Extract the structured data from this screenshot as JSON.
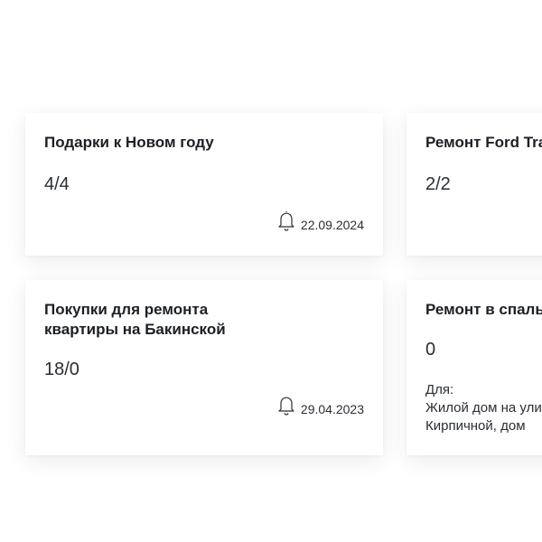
{
  "cards": [
    {
      "title": "Подарки к Новом году",
      "count": "4/4",
      "date": "22.09.2024",
      "icon": "bell-icon"
    },
    {
      "title": "Ремонт Ford Transit",
      "count": "2/2"
    },
    {
      "title": "Покупки для ремонта\nквартиры на Бакинской",
      "count": "18/0",
      "date": "29.04.2023",
      "icon": "bell-icon"
    },
    {
      "title": "Ремонт в спальне",
      "count": "0",
      "for_label": "Для:",
      "address": "Жилой дом на улице\nКирпичной, дом"
    }
  ]
}
